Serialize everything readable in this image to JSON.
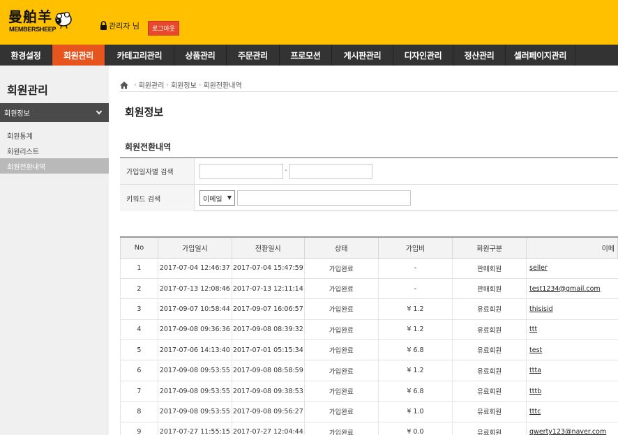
{
  "header": {
    "logo_cn": "曼舶羊",
    "logo_en": "MEMBERSHEEP",
    "user_label": "관리자 님",
    "logout_label": "로그아웃"
  },
  "nav": {
    "items": [
      {
        "label": "환경설정"
      },
      {
        "label": "회원관리",
        "active": true
      },
      {
        "label": "카테고리관리"
      },
      {
        "label": "상품관리"
      },
      {
        "label": "주문관리"
      },
      {
        "label": "프로모션"
      },
      {
        "label": "게시판관리"
      },
      {
        "label": "디자인관리"
      },
      {
        "label": "정산관리"
      },
      {
        "label": "셀러페이지관리"
      }
    ]
  },
  "sidebar": {
    "title": "회원관리",
    "section": "회원정보",
    "links": [
      {
        "label": "회원통계"
      },
      {
        "label": "회원리스트"
      },
      {
        "label": "회원전환내역",
        "active": true
      }
    ]
  },
  "breadcrumb": [
    "회원관리",
    "회원정보",
    "회원전환내역"
  ],
  "page_title": "회원정보",
  "section_title": "회원전환내역",
  "search": {
    "date_label": "가입일자별 검색",
    "date_separator": "-",
    "date_from_value": "",
    "date_to_value": "",
    "keyword_label": "키워드 검색",
    "keyword_type": "이메일",
    "keyword_value": ""
  },
  "table": {
    "columns": [
      "No",
      "가입일시",
      "전환일시",
      "상태",
      "가입비",
      "회원구분",
      "이메"
    ],
    "rows": [
      [
        "1",
        "2017-07-04 12:46:37",
        "2017-07-04 15:47:59",
        "가입완료",
        "-",
        "판매회원",
        "seller"
      ],
      [
        "2",
        "2017-07-13 12:08:46",
        "2017-07-13 12:11:14",
        "가입완료",
        "-",
        "판매회원",
        "test1234@gmail.com"
      ],
      [
        "3",
        "2017-09-07 10:58:44",
        "2017-09-07 16:06:57",
        "가입완료",
        "¥ 1.2",
        "유료회원",
        "thisisid"
      ],
      [
        "4",
        "2017-09-08 09:36:36",
        "2017-09-08 08:39:32",
        "가입완료",
        "¥ 1.2",
        "유료회원",
        "ttt"
      ],
      [
        "5",
        "2017-07-06 14:13:40",
        "2017-07-01 05:15:34",
        "가입완료",
        "¥ 6.8",
        "유료회원",
        "test"
      ],
      [
        "6",
        "2017-09-08 09:53:55",
        "2017-09-08 08:58:59",
        "가입완료",
        "¥ 1.2",
        "유료회원",
        "ttta"
      ],
      [
        "7",
        "2017-09-08 09:53:55",
        "2017-09-08 09:38:53",
        "가입완료",
        "¥ 6.8",
        "유료회원",
        "tttb"
      ],
      [
        "8",
        "2017-09-08 09:53:55",
        "2017-09-08 09:56:27",
        "가입완료",
        "¥ 1.0",
        "유료회원",
        "tttc"
      ],
      [
        "9",
        "2017-07-27 11:55:15",
        "2017-07-27 12:04:44",
        "가입완료",
        "¥ 0.0",
        "유료회원",
        "qwerty123@naver.com"
      ]
    ]
  },
  "colors": {
    "header_bg": "#ffc000",
    "nav_bg": "#333333",
    "nav_active": "#e5551d",
    "logout_bg": "#e8492c"
  },
  "icons": [
    "sheep-logo-icon",
    "lock-icon",
    "chevron-down-icon",
    "home-icon"
  ]
}
